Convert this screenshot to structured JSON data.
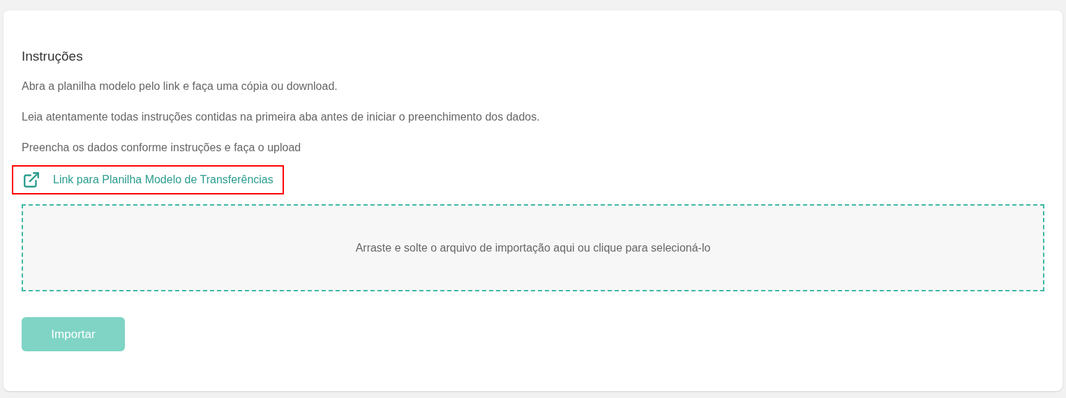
{
  "title": "Instruções",
  "instructions": [
    "Abra a planilha modelo pelo link e faça uma cópia ou download.",
    "Leia atentamente todas instruções contidas na primeira aba antes de iniciar o preenchimento dos dados.",
    "Preencha os dados conforme instruções e faça o upload"
  ],
  "link": {
    "label": "Link para Planilha Modelo de Transferências",
    "highlighted": true
  },
  "dropzone": {
    "text": "Arraste e solte o arquivo de importação aqui ou clique para selecioná-lo"
  },
  "import_button": {
    "label": "Importar",
    "disabled": true
  }
}
